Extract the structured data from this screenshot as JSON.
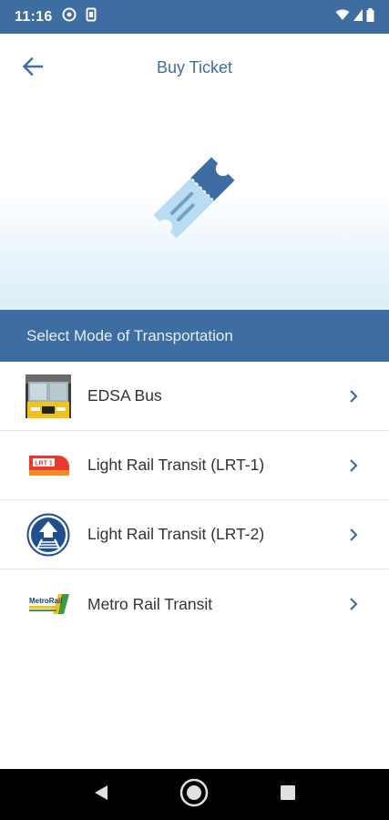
{
  "status_bar": {
    "time": "11:16"
  },
  "header": {
    "title": "Buy Ticket",
    "back_icon": "arrow-left-icon"
  },
  "hero": {
    "icon": "ticket-icon"
  },
  "section": {
    "title": "Select Mode of Transportation"
  },
  "modes": [
    {
      "label": "EDSA Bus",
      "logo_text": ""
    },
    {
      "label": "Light Rail Transit (LRT-1)",
      "logo_text": "LRT 1"
    },
    {
      "label": "Light Rail Transit (LRT-2)",
      "logo_text": ""
    },
    {
      "label": "Metro Rail Transit",
      "logo_text": "MetroRail"
    }
  ],
  "colors": {
    "primary": "#3e6da1",
    "ticket_light": "#b8dcf2",
    "ticket_dark": "#3e6da1",
    "lrt1_red": "#e63a2e",
    "lrt2_blue": "#1f4f8f"
  }
}
